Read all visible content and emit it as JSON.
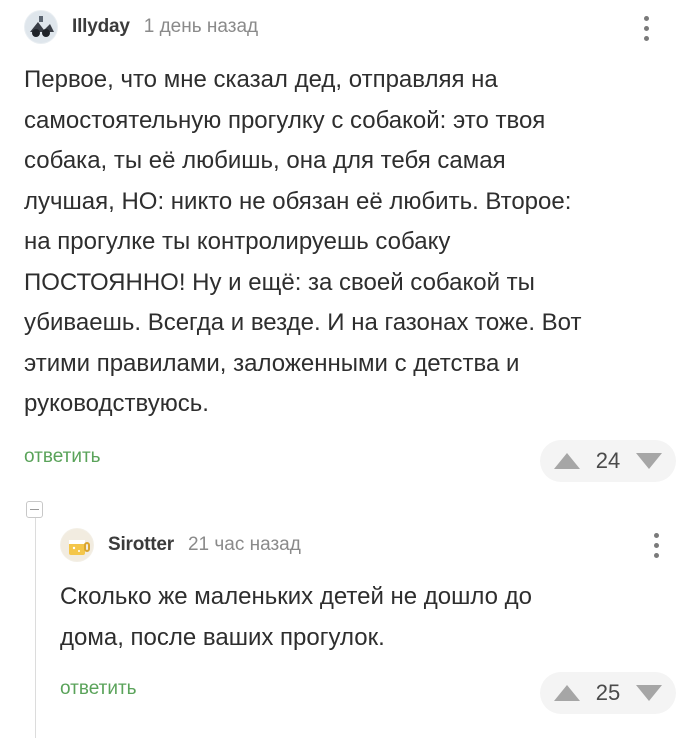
{
  "comments": [
    {
      "username": "Illyday",
      "time": "1 день назад",
      "text": "Первое, что мне сказал дед, отправляя на\nсамостоятельную прогулку с собакой: это твоя\nсобака, ты её любишь, она для тебя самая\nлучшая, НО: никто не обязан её любить. Второе:\nна прогулке ты контролируешь собаку\nПОСТОЯННО! Ну и ещё: за своей собакой ты\nубиваешь. Всегда и везде. И на газонах тоже. Вот\nэтими правилами, заложенными с детства и\nруководствуюсь.",
      "reply_label": "ответить",
      "score": "24"
    },
    {
      "username": "Sirotter",
      "time": "21 час назад",
      "text": "Сколько же маленьких детей не дошло до\nдома, после ваших прогулок.",
      "reply_label": "ответить",
      "score": "25"
    }
  ],
  "colors": {
    "reply_link": "#5aa35a",
    "vote_bg": "#f4f4f4",
    "vote_arrow": "#a6a6a6"
  },
  "icons": [
    "user-avatar",
    "more-vert-icon",
    "upvote-arrow-icon",
    "downvote-arrow-icon",
    "collapse-thread-icon"
  ]
}
